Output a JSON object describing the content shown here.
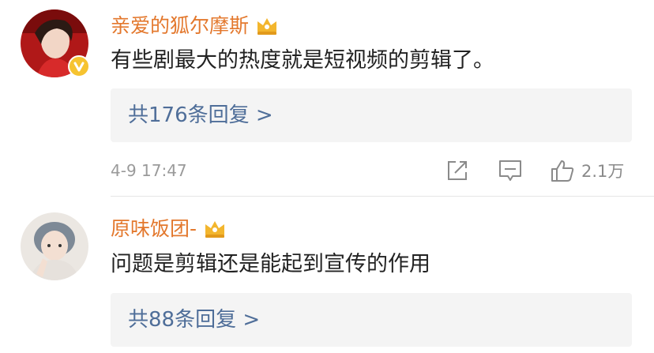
{
  "comments": [
    {
      "username": "亲爱的狐尔摩斯",
      "text": "有些剧最大的热度就是短视频的剪辑了。",
      "reply_link": "共176条回复 >",
      "timestamp": "4-9 17:47",
      "like_count": "2.1万"
    },
    {
      "username": "原味饭团-",
      "text": "问题是剪辑还是能起到宣传的作用",
      "reply_link": "共88条回复 >"
    }
  ],
  "colors": {
    "username": "#e3782d",
    "reply_link": "#4f6e99",
    "reply_bg": "#f4f4f4",
    "verified_badge": "#f6c330",
    "crown": "#f3b62e"
  },
  "icons": {
    "crown": "crown-icon",
    "verified": "verified-badge-icon",
    "share": "share-icon",
    "comment": "comment-icon",
    "like": "thumbs-up-icon"
  }
}
